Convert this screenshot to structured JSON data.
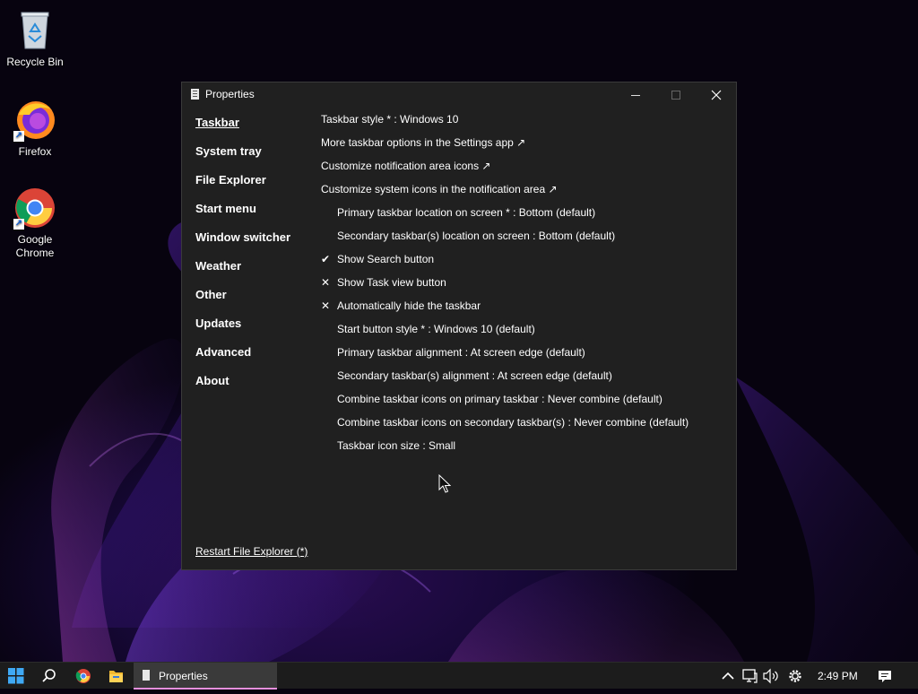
{
  "desktop": {
    "icons": [
      {
        "label": "Recycle Bin"
      },
      {
        "label": "Firefox"
      },
      {
        "label": "Google Chrome"
      }
    ]
  },
  "window": {
    "title": "Properties",
    "nav": [
      {
        "label": "Taskbar",
        "active": true
      },
      {
        "label": "System tray"
      },
      {
        "label": "File Explorer"
      },
      {
        "label": "Start menu"
      },
      {
        "label": "Window switcher"
      },
      {
        "label": "Weather"
      },
      {
        "label": "Other"
      },
      {
        "label": "Updates"
      },
      {
        "label": "Advanced"
      },
      {
        "label": "About"
      }
    ],
    "settings": [
      {
        "text": "Taskbar style * : Windows 10",
        "indent": false,
        "mark": ""
      },
      {
        "text": "More taskbar options in the Settings app ↗",
        "indent": false,
        "mark": ""
      },
      {
        "text": "Customize notification area icons ↗",
        "indent": false,
        "mark": ""
      },
      {
        "text": "Customize system icons in the notification area ↗",
        "indent": false,
        "mark": ""
      },
      {
        "text": "Primary taskbar location on screen * : Bottom (default)",
        "indent": true,
        "mark": ""
      },
      {
        "text": "Secondary taskbar(s) location on screen : Bottom (default)",
        "indent": true,
        "mark": ""
      },
      {
        "text": "Show Search button",
        "indent": true,
        "mark": "✔"
      },
      {
        "text": "Show Task view button",
        "indent": true,
        "mark": "✕"
      },
      {
        "text": "Automatically hide the taskbar",
        "indent": true,
        "mark": "✕"
      },
      {
        "text": "Start button style * : Windows 10 (default)",
        "indent": true,
        "mark": ""
      },
      {
        "text": "Primary taskbar alignment : At screen edge (default)",
        "indent": true,
        "mark": ""
      },
      {
        "text": "Secondary taskbar(s) alignment : At screen edge (default)",
        "indent": true,
        "mark": ""
      },
      {
        "text": "Combine taskbar icons on primary taskbar : Never combine (default)",
        "indent": true,
        "mark": ""
      },
      {
        "text": "Combine taskbar icons on secondary taskbar(s) : Never combine (default)",
        "indent": true,
        "mark": ""
      },
      {
        "text": "Taskbar icon size : Small",
        "indent": true,
        "mark": ""
      }
    ],
    "restart_link": "Restart File Explorer (*)"
  },
  "taskbar": {
    "start_icon": "windows-logo-icon",
    "search_icon": "search-icon",
    "pinned": [
      "chrome-icon",
      "file-explorer-icon"
    ],
    "open_window_label": "Properties",
    "accent_color": "#e58fdc",
    "clock": "2:49 PM"
  }
}
